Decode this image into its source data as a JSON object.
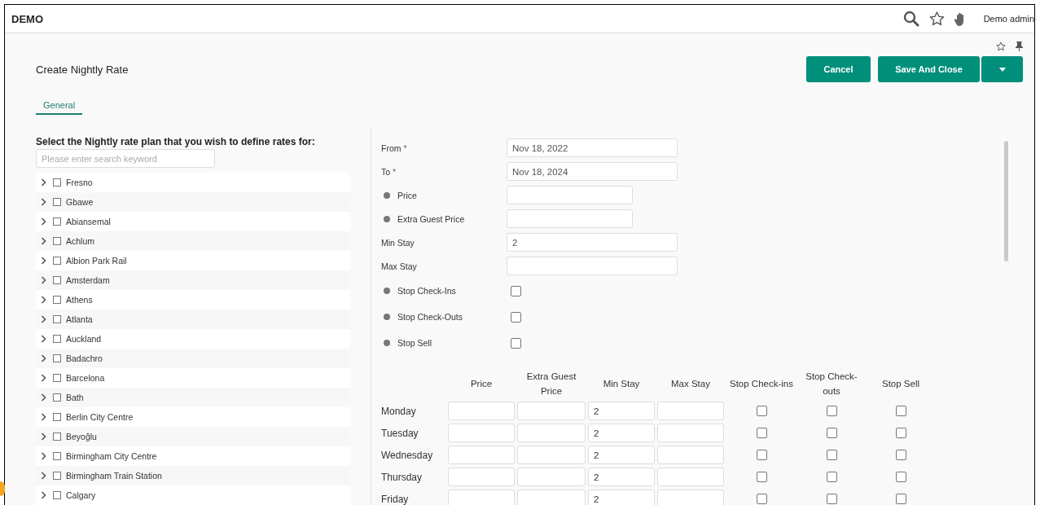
{
  "header": {
    "brand": "DEMO",
    "user": "Demo admin"
  },
  "page": {
    "title": "Create Nightly Rate",
    "buttons": [
      "Cancel",
      "Save And Close"
    ],
    "tabs": [
      {
        "label": "General",
        "selected": true
      }
    ]
  },
  "plan_picker": {
    "heading": "Select the Nightly rate plan that you wish to define rates for:",
    "search": {
      "placeholder": "Please enter search keyword"
    },
    "items": [
      {
        "label": "Fresno",
        "checked": false,
        "expanded": false
      },
      {
        "label": "Gbawe",
        "checked": false,
        "expanded": false
      },
      {
        "label": "Abiansemal",
        "checked": false,
        "expanded": false
      },
      {
        "label": "Achlum",
        "checked": false,
        "expanded": false
      },
      {
        "label": "Albion Park Rail",
        "checked": false,
        "expanded": false
      },
      {
        "label": "Amsterdam",
        "checked": false,
        "expanded": false
      },
      {
        "label": "Athens",
        "checked": false,
        "expanded": false
      },
      {
        "label": "Atlanta",
        "checked": false,
        "expanded": false
      },
      {
        "label": "Auckland",
        "checked": false,
        "expanded": false
      },
      {
        "label": "Badachro",
        "checked": false,
        "expanded": false
      },
      {
        "label": "Barcelona",
        "checked": false,
        "expanded": false
      },
      {
        "label": "Bath",
        "checked": false,
        "expanded": false
      },
      {
        "label": "Berlin City Centre",
        "checked": false,
        "expanded": false
      },
      {
        "label": "Beyoğlu",
        "checked": false,
        "expanded": false
      },
      {
        "label": "Birmingham City Centre",
        "checked": false,
        "expanded": false
      },
      {
        "label": "Birmingham Train Station",
        "checked": false,
        "expanded": false
      },
      {
        "label": "Calgary",
        "checked": false,
        "expanded": false
      }
    ]
  },
  "form": {
    "fields": [
      {
        "kind": "date",
        "label": "From",
        "required_mark": "*",
        "value": "Nov 18, 2022"
      },
      {
        "kind": "date",
        "label": "To",
        "required_mark": "*",
        "value": "Nov 18, 2024"
      },
      {
        "kind": "price",
        "label": "Price",
        "info": true
      },
      {
        "kind": "price",
        "label": "Extra Guest Price",
        "info": true
      },
      {
        "kind": "stay",
        "label": "Min Stay",
        "value": "2"
      },
      {
        "kind": "stay",
        "label": "Max Stay"
      },
      {
        "kind": "toggle",
        "label": "Stop Check-Ins",
        "info": true,
        "checked": false
      },
      {
        "kind": "toggle",
        "label": "Stop Check-Outs",
        "info": true,
        "checked": false
      },
      {
        "kind": "toggle",
        "label": "Stop Sell",
        "info": true,
        "checked": false
      }
    ]
  },
  "weekly": {
    "columns": [
      "Price",
      "Extra Guest Price",
      "Min Stay",
      "Max Stay",
      "Stop Check-ins",
      "Stop Check-outs",
      "Stop Sell"
    ],
    "rows": [
      {
        "day": "Monday",
        "min_stay": "2",
        "stop_check_ins": false,
        "stop_check_outs": false,
        "stop_sell": false
      },
      {
        "day": "Tuesday",
        "min_stay": "2",
        "stop_check_ins": false,
        "stop_check_outs": false,
        "stop_sell": false
      },
      {
        "day": "Wednesday",
        "min_stay": "2",
        "stop_check_ins": false,
        "stop_check_outs": false,
        "stop_sell": false
      },
      {
        "day": "Thursday",
        "min_stay": "2",
        "stop_check_ins": false,
        "stop_check_outs": false,
        "stop_sell": false
      },
      {
        "day": "Friday",
        "min_stay": "2",
        "stop_check_ins": false,
        "stop_check_outs": false,
        "stop_sell": false
      }
    ]
  }
}
